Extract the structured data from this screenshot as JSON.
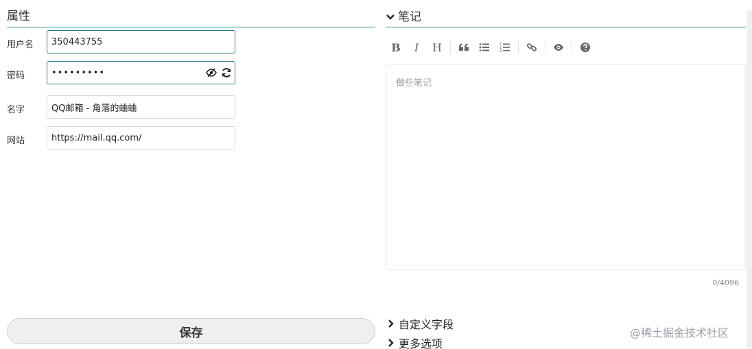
{
  "properties": {
    "title": "属性",
    "fields": [
      {
        "label": "用户名",
        "value": "350443755"
      },
      {
        "label": "密码",
        "value": "•••••••••"
      },
      {
        "label": "名字",
        "value": "QQ邮箱 - 角落的蛐蛐"
      },
      {
        "label": "网站",
        "value": "https://mail.qq.com/"
      }
    ],
    "save_label": "保存"
  },
  "notes": {
    "title": "笔记",
    "toolbar": [
      {
        "label": "B"
      },
      {
        "label": "I"
      },
      {
        "label": "H"
      }
    ],
    "placeholder": "做些笔记",
    "counter": "0/4096"
  },
  "expanders": [
    {
      "label": "自定义字段"
    },
    {
      "label": "更多选项"
    }
  ],
  "watermark": "@稀土掘金技术社区"
}
